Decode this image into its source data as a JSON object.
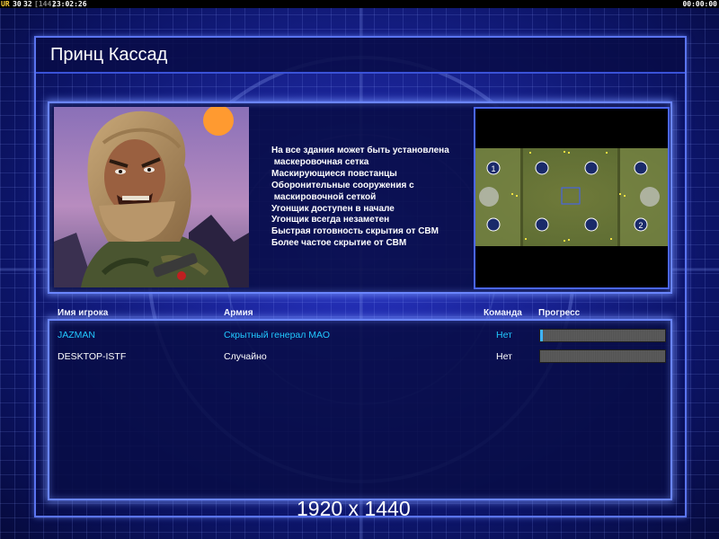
{
  "status_bar": {
    "label": "UR",
    "stat_a": "30",
    "stat_b": "32",
    "stat_c": "[144]",
    "clock": "23:02:26",
    "timer": "00:00:00"
  },
  "title": "Принц Кассад",
  "portrait_icon": "general-portrait",
  "map_features": [
    "На все здания может быть установлена",
    " маскеровочная сетка",
    "Маскирующиеся повстанцы",
    "Оборонительные сооружения с",
    " маскировочной сеткой",
    "Угонщик доступен в начале",
    "Угонщик всегда незаметен",
    "Быстрая готовность скрытия от СВМ",
    "Более частое скрытие от СВМ"
  ],
  "minimap": {
    "start_positions": [
      "1",
      "2"
    ]
  },
  "players_table": {
    "headers": {
      "name": "Имя игрока",
      "army": "Армия",
      "team": "Команда",
      "progress": "Прогресс"
    },
    "rows": [
      {
        "name": "JAZMAN",
        "army": "Скрытный генерал МАО",
        "team": "Нет",
        "progress": 0.02
      },
      {
        "name": "DESKTOP-ISTF",
        "army": "Случайно",
        "team": "Нет",
        "progress": 0
      }
    ]
  },
  "resolution_label": "1920 x 1440",
  "colors": {
    "highlight_player": "#21c8ff",
    "frame": "#6a85ff",
    "progress_fill": "#3fb4ff"
  }
}
